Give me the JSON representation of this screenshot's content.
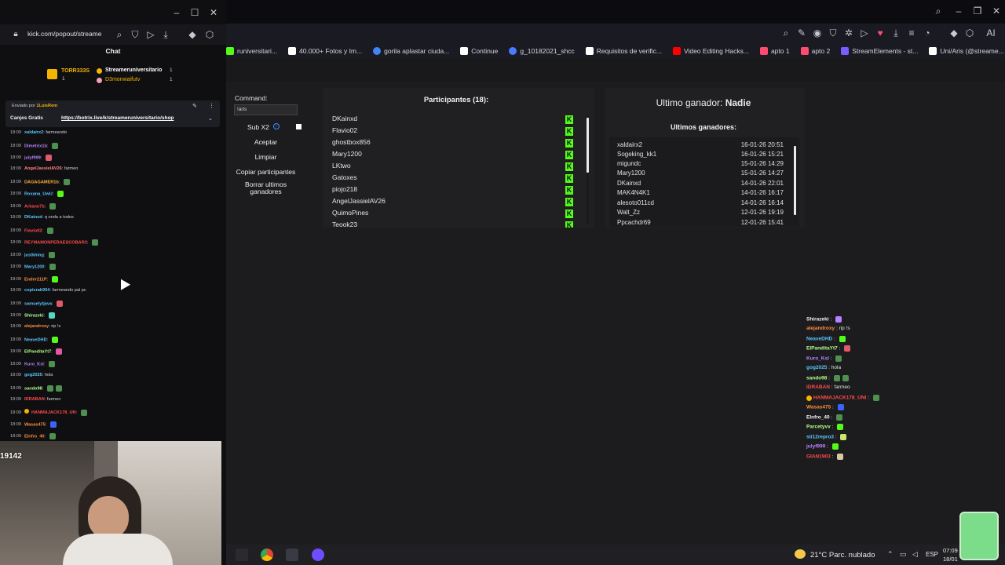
{
  "left_popout": {
    "url": "kick.com/popout/streame",
    "chat_title": "Chat",
    "gift_top": {
      "user1": "TORR333S",
      "user1_count": "1",
      "user2": "Streameruniversitario",
      "user2_count": "1",
      "user3": "D3monwaifutv",
      "user3_count": "1"
    },
    "pinned": {
      "sent_by_label": "Enviado por",
      "sender": "1LuisRem",
      "prefix": "Canjes Gratis",
      "link": "https://botrix.live/k/streameruniversitario/shop"
    },
    "messages": [
      {
        "time": "18:09",
        "user": "xaldairx2",
        "text": "farmeando",
        "color": "#59c7ff"
      },
      {
        "time": "18:09",
        "user": "Dimetrix1b",
        "text": "",
        "color": "#b782ff"
      },
      {
        "time": "18:09",
        "user": "julyf999",
        "text": "",
        "color": "#b782ff"
      },
      {
        "time": "18:09",
        "user": "AngelJassielAV26",
        "text": "farmeo",
        "color": "#ff8080"
      },
      {
        "time": "18:09",
        "user": "DAGAGAMER1b",
        "text": "",
        "color": "#ffb13b"
      },
      {
        "time": "18:09",
        "user": "Roxana_UwU",
        "text": "",
        "color": "#59c7ff"
      },
      {
        "time": "18:09",
        "user": "Arkano7b",
        "text": "",
        "color": "#ff4a4a"
      },
      {
        "time": "18:09",
        "user": "DKainxd",
        "text": "q onda a todos",
        "color": "#59c7ff"
      },
      {
        "time": "18:09",
        "user": "Flavio02",
        "text": "",
        "color": "#ff4a4a"
      },
      {
        "time": "18:09",
        "user": "REYMAMONPERAESCOBAR3",
        "text": "",
        "color": "#ff4a4a"
      },
      {
        "time": "18:09",
        "user": "justkhing",
        "text": "",
        "color": "#59c7ff"
      },
      {
        "time": "18:09",
        "user": "Mary1200",
        "text": "",
        "color": "#59c7ff"
      },
      {
        "time": "18:09",
        "user": "Ender211P",
        "text": "",
        "color": "#ff8c3b"
      },
      {
        "time": "18:09",
        "user": "copicrak904",
        "text": "farmeando pal pc",
        "color": "#59c7ff"
      },
      {
        "time": "18:09",
        "user": "samuelytjava",
        "text": "",
        "color": "#59c7ff"
      },
      {
        "time": "18:09",
        "user": "Shirazeki",
        "text": "",
        "color": "#b4ff8a"
      },
      {
        "time": "18:09",
        "user": "alejandroxy",
        "text": "rip !s",
        "color": "#ff8c3b"
      },
      {
        "time": "18:09",
        "user": "NeaveDHD",
        "text": "",
        "color": "#59c7ff"
      },
      {
        "time": "18:09",
        "user": "ElPanditaYt7",
        "text": "",
        "color": "#b4ff8a"
      },
      {
        "time": "18:09",
        "user": "Kuro_Ksl",
        "text": "",
        "color": "#b782ff"
      },
      {
        "time": "18:09",
        "user": "gog2025",
        "text": "hola",
        "color": "#59c7ff"
      },
      {
        "time": "18:09",
        "user": "sando98",
        "text": "",
        "color": "#b4ff8a"
      },
      {
        "time": "18:09",
        "user": "IDRABAN",
        "text": "farmeo",
        "color": "#ff4a4a"
      },
      {
        "time": "18:09",
        "user": "HANMAJACK178_UN",
        "text": "",
        "color": "#ff4a4a"
      },
      {
        "time": "18:09",
        "user": "Wasas475",
        "text": "",
        "color": "#ff8c3b"
      },
      {
        "time": "18:09",
        "user": "Elnfro_40",
        "text": "",
        "color": "#ff8c3b"
      }
    ],
    "webcam_overlay_text": "19142"
  },
  "bookmarks": [
    {
      "label": "runiversitari...",
      "color": "#53fc18"
    },
    {
      "label": "40.000+ Fotos y Im...",
      "color": "#ffffff"
    },
    {
      "label": "gorila aplastar ciuda...",
      "color": "#4285f4"
    },
    {
      "label": "Continue",
      "color": "#ffffff"
    },
    {
      "label": "g_10182021_shcc",
      "color": "#4a7bff"
    },
    {
      "label": "Requisitos de verific...",
      "color": "#ffffff"
    },
    {
      "label": "Video Editing Hacks...",
      "color": "#ff0000"
    },
    {
      "label": "apto 1",
      "color": "#ff4b6e"
    },
    {
      "label": "apto 2",
      "color": "#ff4b6e"
    },
    {
      "label": "StreamElements - st...",
      "color": "#7a5cff"
    },
    {
      "label": "Uni/Aris (@streame...",
      "color": "#ffffff"
    }
  ],
  "panel": {
    "command_label": "Command:",
    "command_value": "!aris",
    "sub_label": "Sub X2",
    "accept": "Aceptar",
    "clear": "Limpiar",
    "copy_participants": "Copiar participantes",
    "delete_winners": "Borrar ultimos ganadores",
    "participants_title": "Participantes (18):",
    "participants": [
      "DKainxd",
      "Flavio02",
      "ghostbox856",
      "Mary1200",
      "LKtwo",
      "Gatoxes",
      "piojo218",
      "AngelJassielAV26",
      "QuimoPines",
      "Teook23"
    ],
    "last_winner_label": "Ultimo ganador:",
    "last_winner_value": "Nadie",
    "winners_title": "Ultimos ganadores:",
    "winners": [
      {
        "name": "xaldairx2",
        "date": "16-01-26 20:51"
      },
      {
        "name": "Sogeking_kk1",
        "date": "16-01-26 15:21"
      },
      {
        "name": "migundc",
        "date": "15-01-26 14:29"
      },
      {
        "name": "Mary1200",
        "date": "15-01-26 14:27"
      },
      {
        "name": "DKainxd",
        "date": "14-01-26 22:01"
      },
      {
        "name": "MAK4N4K1",
        "date": "14-01-26 16:17"
      },
      {
        "name": "alesoto011cd",
        "date": "14-01-26 16:14"
      },
      {
        "name": "Walt_Zz",
        "date": "12-01-26 19:19"
      },
      {
        "name": "Ppcachdr69",
        "date": "12-01-26 15:41"
      }
    ]
  },
  "overlay_chat": [
    {
      "user": "Shirazeki",
      "text": "",
      "color": "#f2f2f2"
    },
    {
      "user": "alejandroxy",
      "text": "rip !s",
      "color": "#ff8c3b"
    },
    {
      "user": "NeaveDHD",
      "text": "",
      "color": "#59c7ff"
    },
    {
      "user": "ElPanditaYt7",
      "text": "",
      "color": "#b4ff8a"
    },
    {
      "user": "Kuro_Ksl",
      "text": "",
      "color": "#b782ff"
    },
    {
      "user": "gog2025",
      "text": "hola",
      "color": "#59c7ff"
    },
    {
      "user": "sando98",
      "text": "",
      "color": "#b4ff8a"
    },
    {
      "user": "IDRABAN",
      "text": "farmeo",
      "color": "#ff4a4a"
    },
    {
      "user": "HANMAJACK178_UNI",
      "text": "",
      "color": "#ff4a4a"
    },
    {
      "user": "Wasas475",
      "text": "",
      "color": "#ff8c3b"
    },
    {
      "user": "Elnfro_40",
      "text": "",
      "color": "#f2f2f2"
    },
    {
      "user": "Parcetyvv",
      "text": "",
      "color": "#b4ff8a"
    },
    {
      "user": "sti12repro3",
      "text": "",
      "color": "#59c7ff"
    },
    {
      "user": "julyf999",
      "text": "",
      "color": "#b782ff"
    },
    {
      "user": "GIAN1903",
      "text": "",
      "color": "#ff4a4a"
    }
  ],
  "taskbar": {
    "weather": "21°C Parc. nublado",
    "lang": "ESP",
    "time": "07:09",
    "date": "18/01"
  }
}
